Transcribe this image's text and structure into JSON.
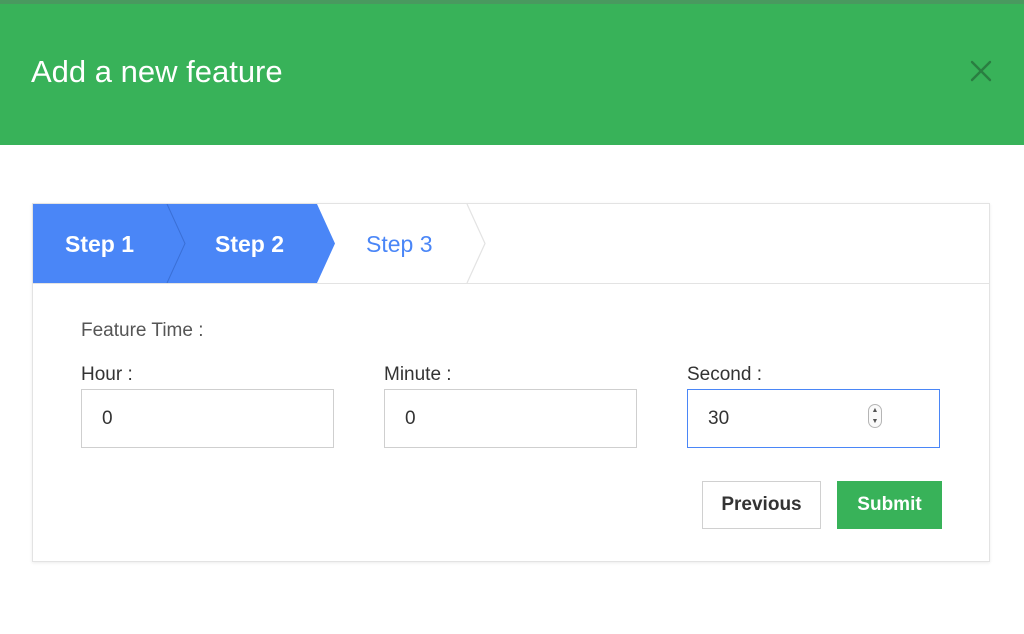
{
  "modal": {
    "title": "Add a new feature",
    "close_icon": "close-icon"
  },
  "steps": [
    {
      "label": "Step 1",
      "state": "complete"
    },
    {
      "label": "Step 2",
      "state": "active"
    },
    {
      "label": "Step 3",
      "state": "upcoming"
    }
  ],
  "form": {
    "section_label": "Feature Time :",
    "hour": {
      "label": "Hour :",
      "value": "0"
    },
    "minute": {
      "label": "Minute :",
      "value": "0"
    },
    "second": {
      "label": "Second :",
      "value": "30"
    }
  },
  "actions": {
    "previous_label": "Previous",
    "submit_label": "Submit"
  },
  "colors": {
    "header_green": "#38b259",
    "step_blue": "#4a86f7",
    "submit_green": "#38b259"
  }
}
